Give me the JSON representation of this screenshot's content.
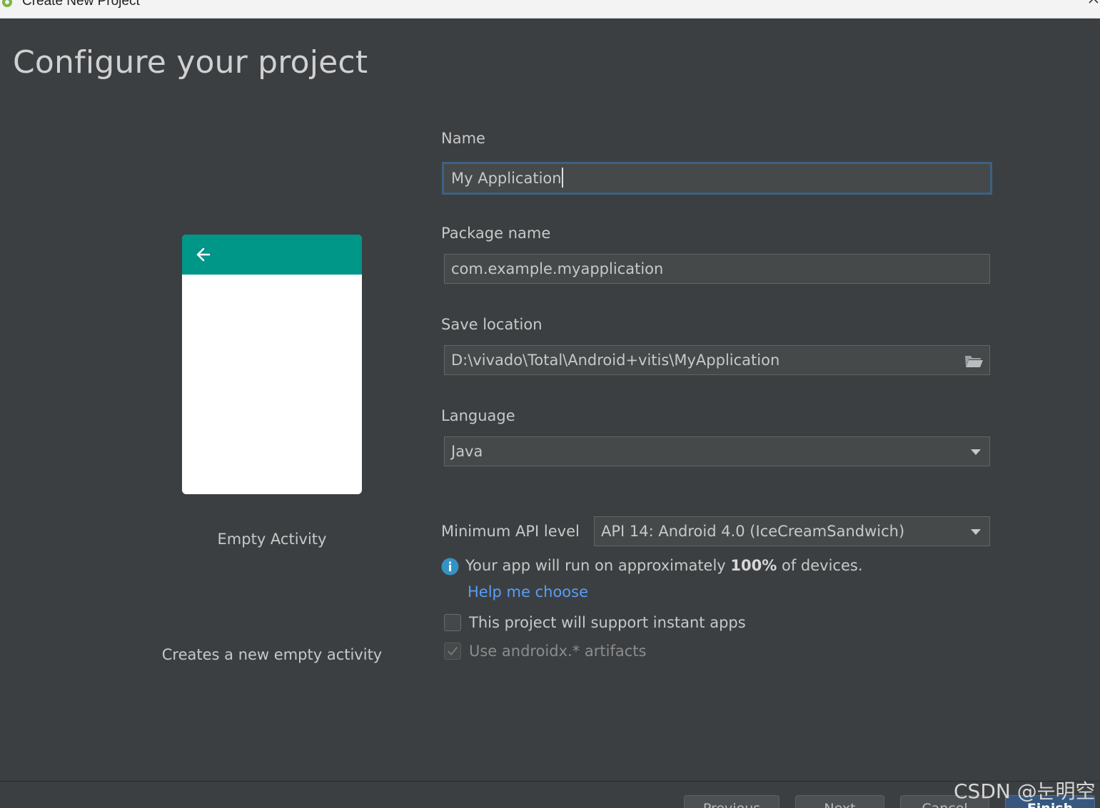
{
  "window": {
    "title": "Create New Project",
    "app_icon": "android-studio-icon",
    "close_icon": "close-icon"
  },
  "page": {
    "heading": "Configure your project"
  },
  "preview": {
    "back_icon": "arrow-back-icon",
    "appbar_color": "#009688",
    "activity_name": "Empty Activity",
    "activity_description": "Creates a new empty activity"
  },
  "form": {
    "name": {
      "label": "Name",
      "value": "My Application"
    },
    "package": {
      "label": "Package name",
      "value": "com.example.myapplication"
    },
    "save_location": {
      "label": "Save location",
      "value": "D:\\vivado\\Total\\Android+vitis\\MyApplication",
      "icon": "folder-open-icon"
    },
    "language": {
      "label": "Language",
      "value": "Java"
    },
    "min_api": {
      "label": "Minimum API level",
      "value": "API 14: Android 4.0 (IceCreamSandwich)"
    },
    "info": {
      "icon": "info-icon",
      "text_before": "Your app will run on approximately ",
      "percent": "100%",
      "text_after": " of devices."
    },
    "help_link": "Help me choose",
    "instant_apps": {
      "label": "This project will support instant apps",
      "checked": false
    },
    "androidx": {
      "label": "Use androidx.* artifacts",
      "checked": true,
      "enabled": false
    }
  },
  "footer": {
    "buttons": [
      {
        "label": "Previous"
      },
      {
        "label": "Next"
      },
      {
        "label": "Cancel"
      },
      {
        "label": "Finish"
      }
    ]
  },
  "watermark": "CSDN @눈明空",
  "colors": {
    "background": "#3c3f41",
    "accent_link": "#589df6",
    "focus_border": "#3d6185",
    "primary_button": "#365880"
  }
}
